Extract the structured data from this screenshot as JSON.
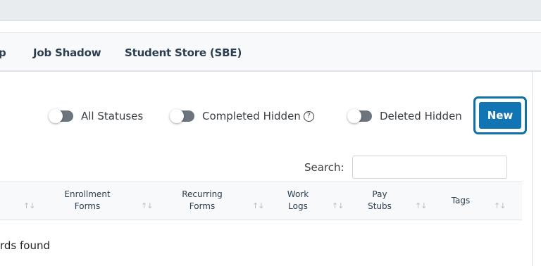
{
  "tabs": [
    "ip",
    "Job Shadow",
    "Student Store (SBE)"
  ],
  "filters": {
    "all_statuses": "All Statuses",
    "completed_hidden": "Completed Hidden",
    "help_glyph": "?",
    "deleted_hidden": "Deleted Hidden"
  },
  "new_button": "New",
  "search": {
    "label": "Search:",
    "value": ""
  },
  "table": {
    "columns": [
      [
        "Enrollment",
        "Forms"
      ],
      [
        "Recurring",
        "Forms"
      ],
      [
        "Work",
        "Logs"
      ],
      [
        "Pay",
        "Stubs"
      ],
      [
        "Tags"
      ]
    ],
    "sort_glyph": "↑↓",
    "empty_text": "rds found"
  },
  "colors": {
    "primary": "#1275b3",
    "toggle_off": "#6c757d",
    "header_bg": "#f8f9fa"
  }
}
